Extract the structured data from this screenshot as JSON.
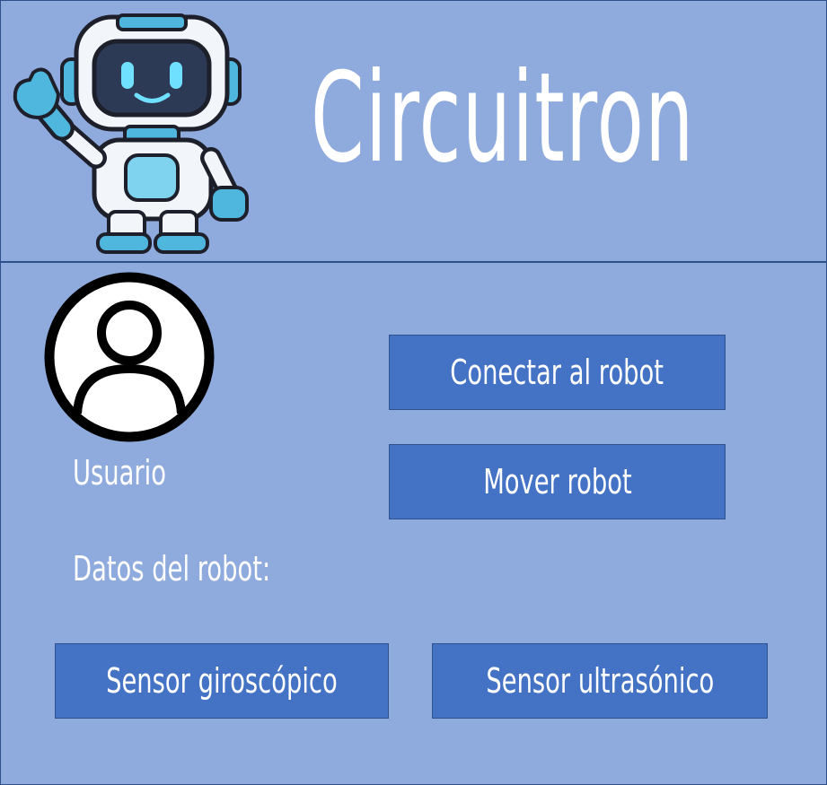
{
  "app": {
    "title": "Circuitron"
  },
  "icons": {
    "mascot": "robot-mascot-icon",
    "avatar": "user-avatar-icon"
  },
  "user": {
    "label": "Usuario"
  },
  "robot_data": {
    "label": "Datos del robot:"
  },
  "buttons": {
    "connect": "Conectar al robot",
    "move": "Mover robot",
    "gyro": "Sensor giroscópico",
    "ultrasonic": "Sensor ultrasónico"
  },
  "colors": {
    "background": "#8faadc",
    "button": "#4472c4",
    "divider": "#2f4f8a",
    "text": "#ffffff"
  }
}
